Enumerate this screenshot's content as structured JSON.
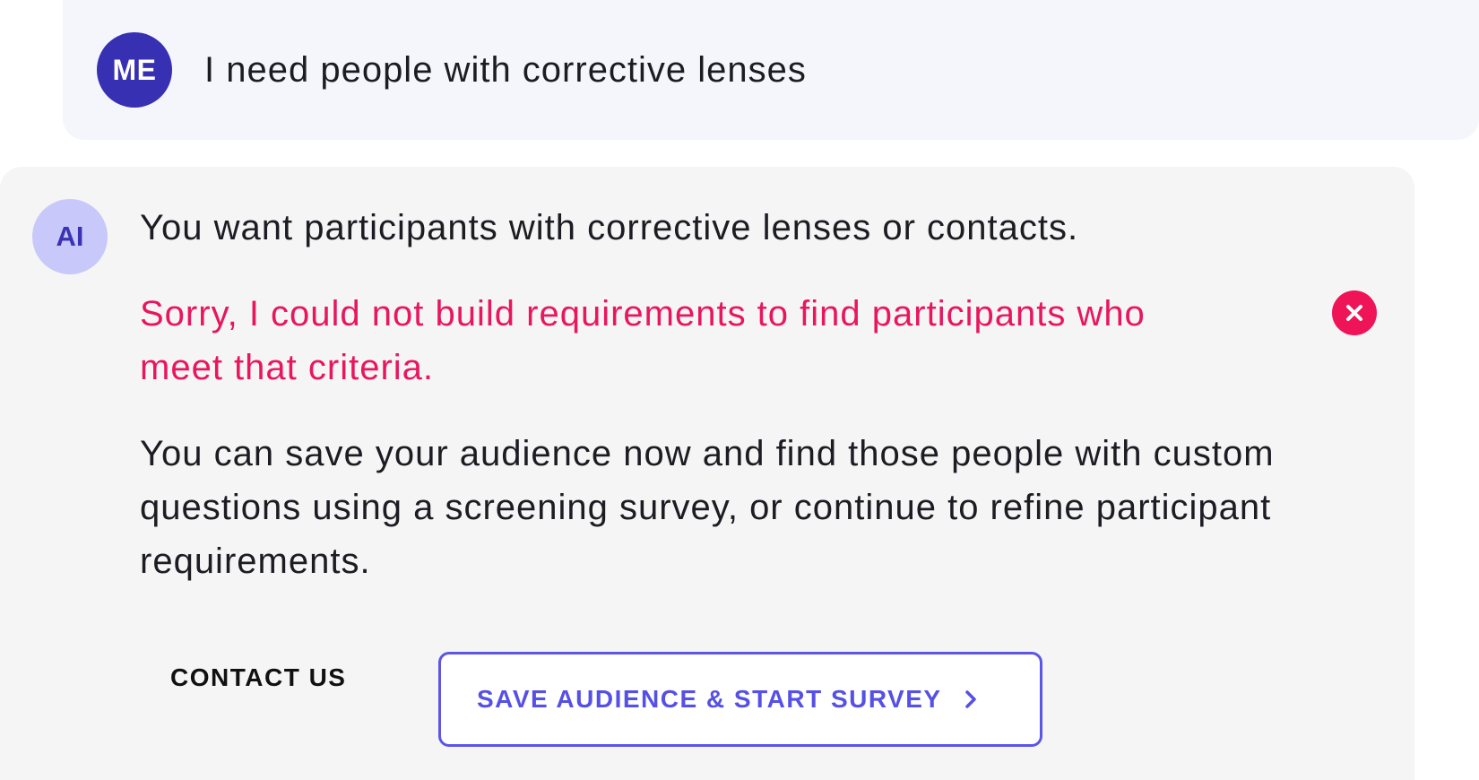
{
  "user_message": {
    "avatar_label": "ME",
    "text": "I need people with corrective lenses"
  },
  "ai_message": {
    "avatar_label": "AI",
    "summary": "You want participants with corrective lenses or contacts.",
    "error_text": "Sorry, I could not build requirements to find participants who meet that criteria.",
    "body_text": "You can save your audience now and find those people with custom questions using a screening survey, or continue to refine participant requirements.",
    "actions": {
      "contact_label": "CONTACT US",
      "primary_label": "SAVE AUDIENCE & START SURVEY"
    }
  },
  "icons": {
    "error": "close-circle-icon",
    "primary_chevron": "chevron-right-icon"
  },
  "colors": {
    "me_avatar": "#3730b3",
    "ai_avatar_bg": "#c8c8fa",
    "error": "#e8175d",
    "accent": "#5550e6"
  }
}
